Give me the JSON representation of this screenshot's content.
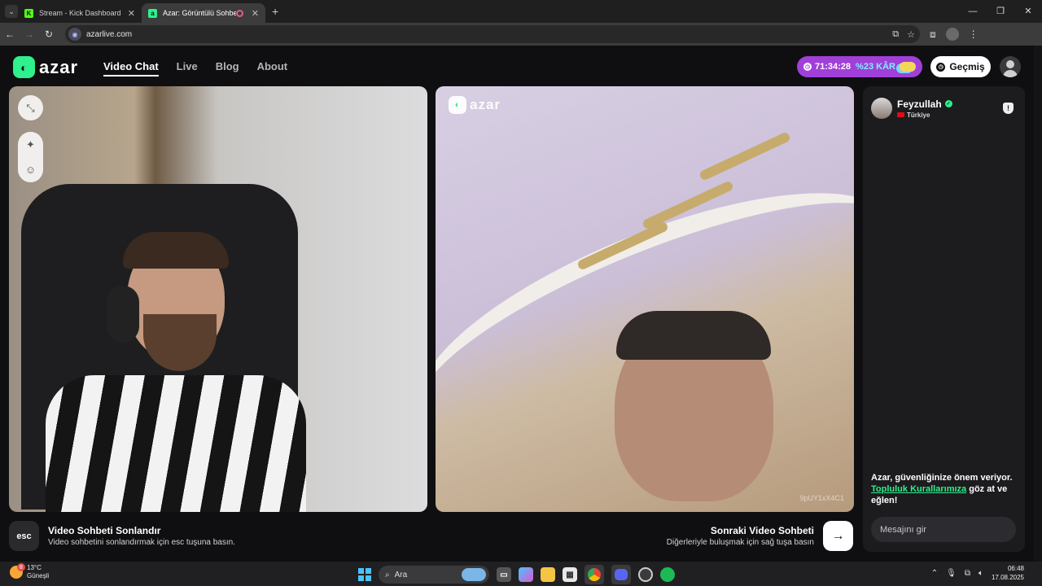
{
  "browser": {
    "tabs": [
      {
        "title": "Stream - Kick Dashboard",
        "favicon": "K"
      },
      {
        "title": "Azar: Görüntülü Sohbet, Ar",
        "favicon": "a"
      }
    ],
    "url": "azarlive.com"
  },
  "header": {
    "logo_text": "azar",
    "nav": [
      "Video Chat",
      "Live",
      "Blog",
      "About"
    ],
    "promo_timer": "71:34:28",
    "promo_profit": "%23 KÂR",
    "history_label": "Geçmiş"
  },
  "video": {
    "watermark": "azar",
    "code": "9pUY1xX4C1"
  },
  "controls": {
    "esc_key": "esc",
    "end_title": "Video Sohbeti Sonlandır",
    "end_sub": "Video sohbetini sonlandırmak için esc tuşuna basın.",
    "next_title": "Sonraki Video Sohbeti",
    "next_sub": "Diğerleriyle buluşmak için sağ tuşa basın"
  },
  "chat": {
    "peer_name": "Feyzullah",
    "peer_country": "Türkiye",
    "safety_pre": "Azar, güvenliğinize önem veriyor.",
    "safety_link": "Topluluk Kurallarımıza",
    "safety_post": "göz at ve eğlen!",
    "input_placeholder": "Mesajını gir"
  },
  "taskbar": {
    "weather_badge": "8",
    "temp": "13°C",
    "weather_desc": "Güneşli",
    "search_placeholder": "Ara",
    "time": "06:48",
    "date": "17.08.2025"
  },
  "colors": {
    "brand": "#2ef08c",
    "promo": "#a13fd9"
  }
}
